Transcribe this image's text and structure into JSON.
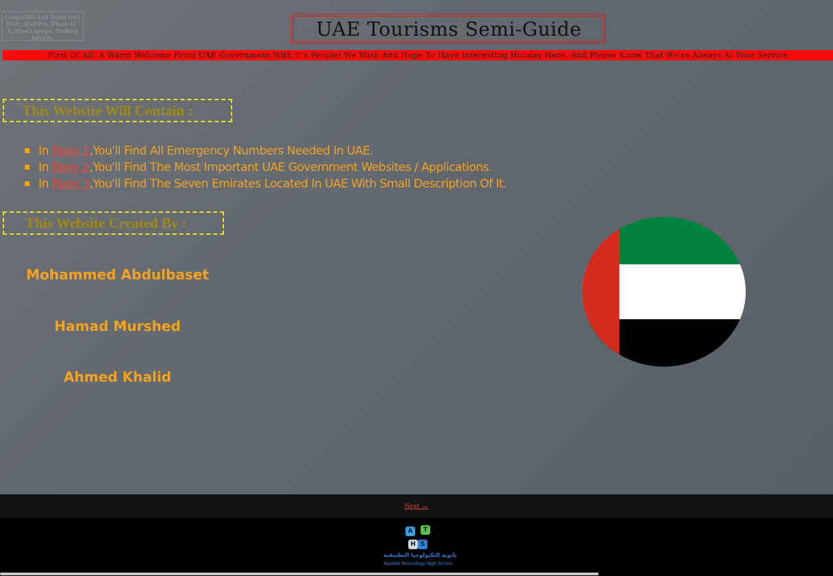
{
  "compat_notice": "Compatible And Tested Only With : iPad Pro, iPhone 11 / X, Most Laptops / Desktop Devices.",
  "title": "UAE Tourisms Semi-Guide",
  "banner": "First Of All, A Warm Welcome From UAE Government With It's People! We Wish And Hope To Have Interesting Holiday Here, And Please Know That We're Always At Your Service",
  "contains_heading": "This Website Will Contain :",
  "contents": [
    {
      "prefix": "In ",
      "link": "Page 1",
      "text": ",You'll Find All Emergency Numbers Needed In UAE."
    },
    {
      "prefix": "In ",
      "link": "Page 2",
      "text": ",You'll Find The Most Important UAE Government Websites / Applications."
    },
    {
      "prefix": "In ",
      "link": "Page 3",
      "text": ",You'll Find The Seven Emirates Located In UAE With Small Description Of It."
    }
  ],
  "created_heading": "This Website Created By :",
  "authors": [
    "Mohammed Abdulbaset",
    "Hamad Murshed",
    "Ahmed Khalid"
  ],
  "flag": {
    "icon": "uae-flag-icon",
    "colors": {
      "red": "#d52b1e",
      "green": "#00843d",
      "white": "#ffffff",
      "black": "#000000"
    }
  },
  "nav": {
    "next_label": "Next →"
  },
  "logo": {
    "icon": "aths-logo-icon",
    "letters": [
      "A",
      "T",
      "H",
      "S"
    ],
    "arabic": "ثانوية التكنولوجيا التطبيقية",
    "english": "Applied Technology High School"
  },
  "colors": {
    "accent_orange": "#f5a31f",
    "link_red": "#e8453c",
    "heading_gold": "#a18a12",
    "dashed_yellow": "#f2e21c",
    "banner_red": "#ff0a0a"
  }
}
